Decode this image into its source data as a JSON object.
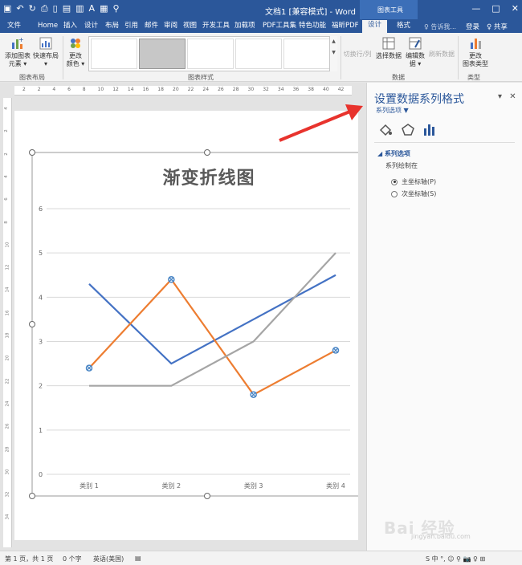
{
  "window": {
    "title": "文档1 [兼容模式] - Word",
    "context_tab_group": "图表工具",
    "controls": [
      "—",
      "□",
      "✕"
    ]
  },
  "ribbon_tabs": {
    "items": [
      "文件",
      "Home",
      "插入",
      "设计",
      "布局",
      "引用",
      "邮件",
      "审阅",
      "视图",
      "开发工具",
      "加载项",
      "PDF工具集",
      "特色功能",
      "福昕PDF",
      "设计",
      "格式"
    ],
    "active_index": 14,
    "tell_me": "♀ 告诉我...",
    "login": "登录",
    "share": "♀ 共享"
  },
  "ribbon": {
    "add_element": [
      "添加图表",
      "元素 ▾"
    ],
    "quick_layout": [
      "快速布局",
      "▾"
    ],
    "change_colors": [
      "更改",
      "颜色 ▾"
    ],
    "switch_row_col": "切换行/列",
    "select_data": "选择数据",
    "edit_data": [
      "编辑数",
      "据 ▾"
    ],
    "refresh_data": "刷新数据",
    "change_type": [
      "更改",
      "图表类型"
    ],
    "group_layout": "图表布局",
    "group_styles": "图表样式",
    "group_data": "数据",
    "group_type": "类型"
  },
  "ruler": {
    "h_ticks": [
      "2",
      "2",
      "4",
      "6",
      "8",
      "10",
      "12",
      "14",
      "16",
      "18",
      "20",
      "22",
      "24",
      "26",
      "28",
      "30",
      "32",
      "34",
      "36",
      "38",
      "40",
      "42"
    ],
    "v_ticks": [
      "4",
      "2",
      "2",
      "4",
      "6",
      "8",
      "10",
      "12",
      "14",
      "16",
      "18",
      "20",
      "22",
      "24",
      "26",
      "28",
      "30",
      "32",
      "34"
    ]
  },
  "chart_data": {
    "type": "line",
    "title": "渐变折线图",
    "categories": [
      "类别 1",
      "类别 2",
      "类别 3",
      "类别 4"
    ],
    "series": [
      {
        "values": [
          4.3,
          2.5,
          3.5,
          4.5
        ],
        "color": "#4472c4"
      },
      {
        "values": [
          2.4,
          4.4,
          1.8,
          2.8
        ],
        "color": "#ed7d31"
      },
      {
        "values": [
          2.0,
          2.0,
          3.0,
          5.0
        ],
        "color": "#a5a5a5"
      }
    ],
    "yticks": [
      "0",
      "1",
      "2",
      "3",
      "4",
      "5",
      "6"
    ],
    "ylim": [
      0,
      6
    ],
    "selected_series": 1,
    "grid": true
  },
  "pane": {
    "title": "设置数据系列格式",
    "subtitle": "系列选项 ▼",
    "section": "◢ 系列选项",
    "plot_on_label": "系列绘制在",
    "options": [
      {
        "label": "主坐标轴(P)",
        "checked": true
      },
      {
        "label": "次坐标轴(S)",
        "checked": false
      }
    ]
  },
  "status": {
    "page": "第 1 页，共 1 页",
    "words": "0 个字",
    "lang": "英语(美国)",
    "input_tray": "S 中 °, ☺ ⚲ 📷 ♀ ⊞"
  },
  "watermark": {
    "brand": "Bai 经验",
    "url": "jingyan.baidu.com"
  },
  "colors": {
    "accent": "#2b579a",
    "arrow": "#e8332d"
  }
}
